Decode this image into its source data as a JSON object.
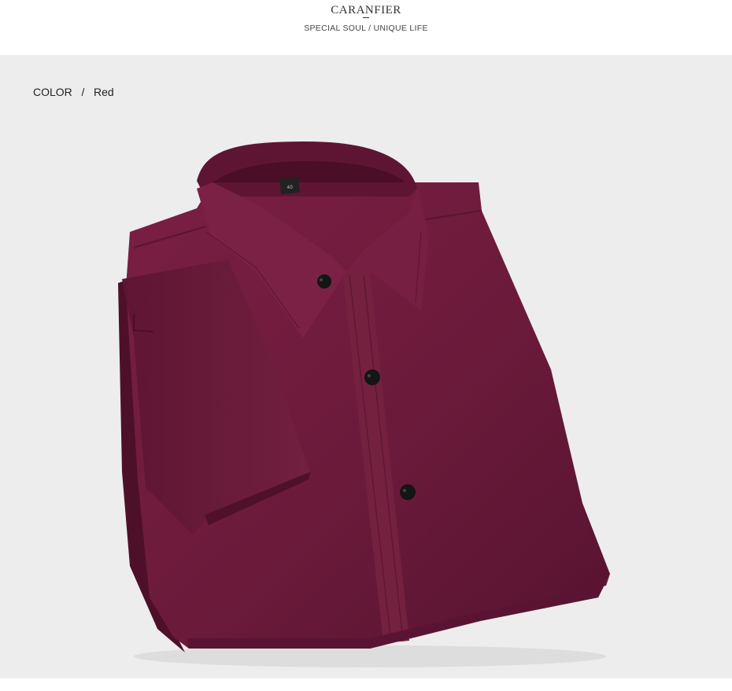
{
  "header": {
    "brand": "CARANFIER",
    "tagline": "SPECIAL SOUL / UNIQUE LIFE"
  },
  "product": {
    "color_label": "COLOR",
    "separator": "/",
    "color_value": "Red",
    "shirt_color": "#6b1a3a",
    "background_color": "#ededed"
  },
  "icons": {
    "brand_dash": "dash-icon",
    "shirt": "shirt-icon"
  }
}
